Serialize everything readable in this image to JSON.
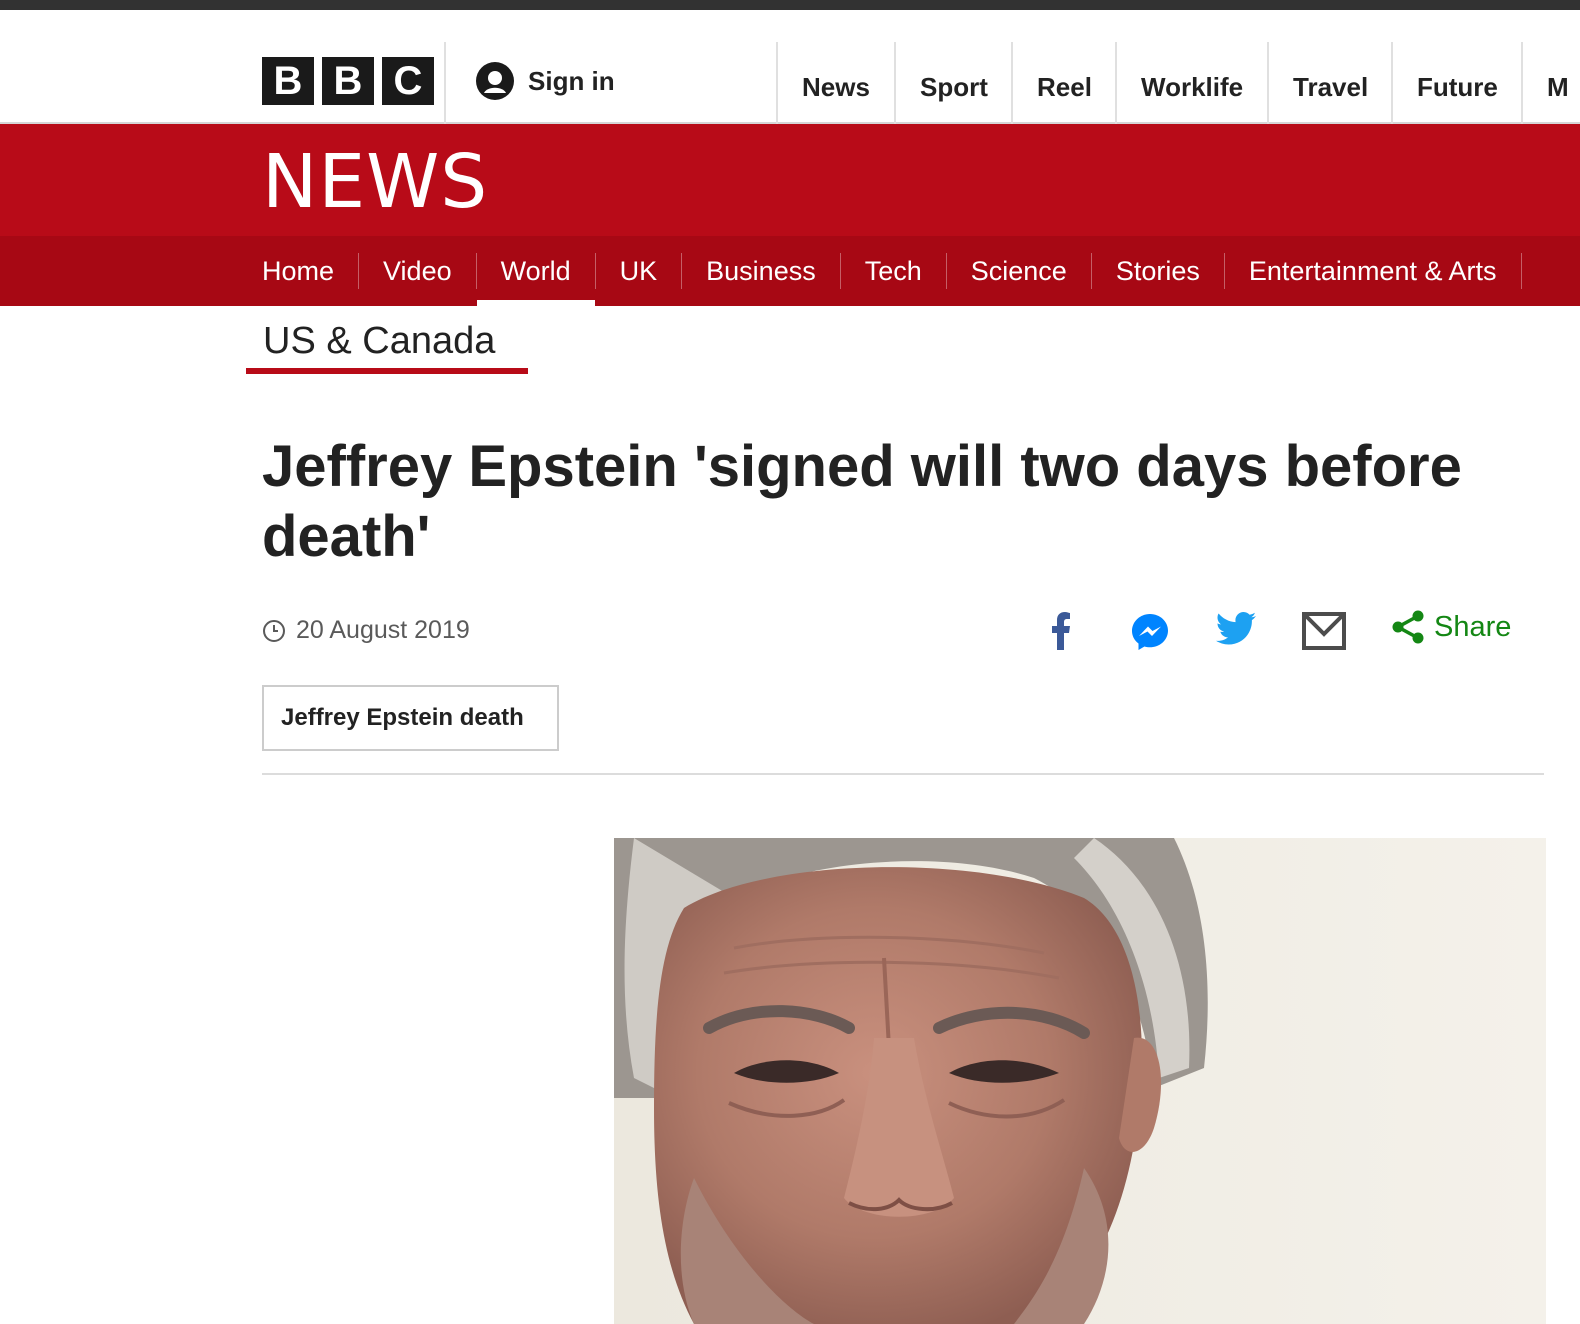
{
  "brand": {
    "logo_letters": [
      "B",
      "B",
      "C"
    ],
    "section_brand": "NEWS",
    "accent_color": "#b80b18"
  },
  "account": {
    "sign_in_label": "Sign in",
    "icon": "user-icon"
  },
  "top_nav": {
    "items": [
      "News",
      "Sport",
      "Reel",
      "Worklife",
      "Travel",
      "Future",
      "M"
    ]
  },
  "sub_nav": {
    "items": [
      "Home",
      "Video",
      "World",
      "UK",
      "Business",
      "Tech",
      "Science",
      "Stories",
      "Entertainment & Arts"
    ],
    "active": "World"
  },
  "section": {
    "title": "US & Canada"
  },
  "article": {
    "headline": "Jeffrey Epstein 'signed will two days before death'",
    "date": "20 August 2019",
    "tag": "Jeffrey Epstein death"
  },
  "share": {
    "label": "Share",
    "icons": [
      "facebook-icon",
      "messenger-icon",
      "twitter-icon",
      "email-icon",
      "share-icon"
    ],
    "label_color": "#148714"
  }
}
